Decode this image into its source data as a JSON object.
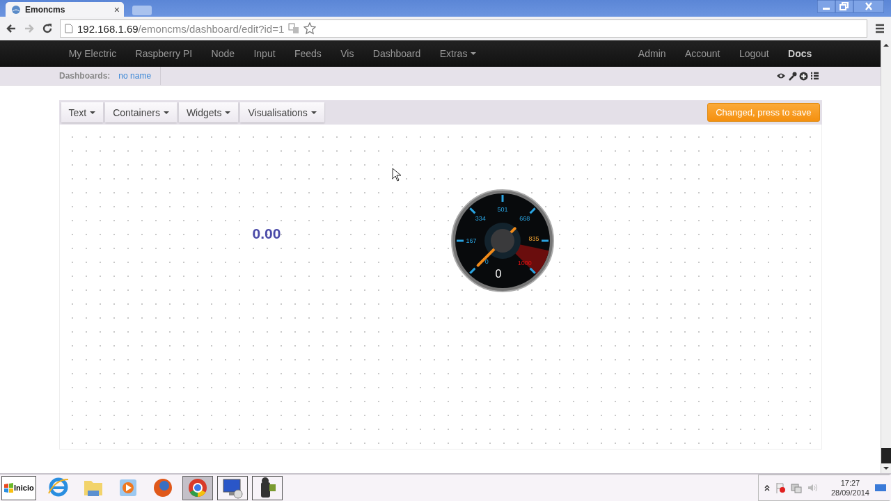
{
  "browser": {
    "tab_title": "Emoncms",
    "tab_close": "×",
    "url_host": "192.168.1.69",
    "url_path": "/emoncms/dashboard/edit?id=1"
  },
  "nav": {
    "left": [
      {
        "label": "My Electric",
        "dropdown": false
      },
      {
        "label": "Raspberry PI",
        "dropdown": false
      },
      {
        "label": "Node",
        "dropdown": false
      },
      {
        "label": "Input",
        "dropdown": false
      },
      {
        "label": "Feeds",
        "dropdown": false
      },
      {
        "label": "Vis",
        "dropdown": false
      },
      {
        "label": "Dashboard",
        "dropdown": false
      },
      {
        "label": "Extras",
        "dropdown": true
      }
    ],
    "right": [
      {
        "label": "Admin",
        "emphasized": false
      },
      {
        "label": "Account",
        "emphasized": false
      },
      {
        "label": "Logout",
        "emphasized": false
      },
      {
        "label": "Docs",
        "emphasized": true
      }
    ]
  },
  "subbar": {
    "label": "Dashboards:",
    "link": "no name"
  },
  "toolbar": {
    "menus": [
      "Text",
      "Containers",
      "Widgets",
      "Visualisations"
    ],
    "save_button": "Changed, press to save"
  },
  "widgets": [
    {
      "kind": "text",
      "value": "0.00"
    },
    {
      "kind": "gauge",
      "scale": [
        "0",
        "167",
        "334",
        "501",
        "668",
        "835",
        "1000"
      ],
      "reading": "0"
    }
  ],
  "taskbar": {
    "start": "Inicio",
    "apps": [
      {
        "kind": "ie",
        "selected": false
      },
      {
        "kind": "folder",
        "selected": false
      },
      {
        "kind": "media",
        "selected": false
      },
      {
        "kind": "firefox",
        "selected": false
      },
      {
        "kind": "chrome",
        "selected": true
      },
      {
        "kind": "remote",
        "selected": false
      },
      {
        "kind": "camera",
        "selected": false
      }
    ],
    "time": "17:27",
    "date": "28/09/2014"
  }
}
